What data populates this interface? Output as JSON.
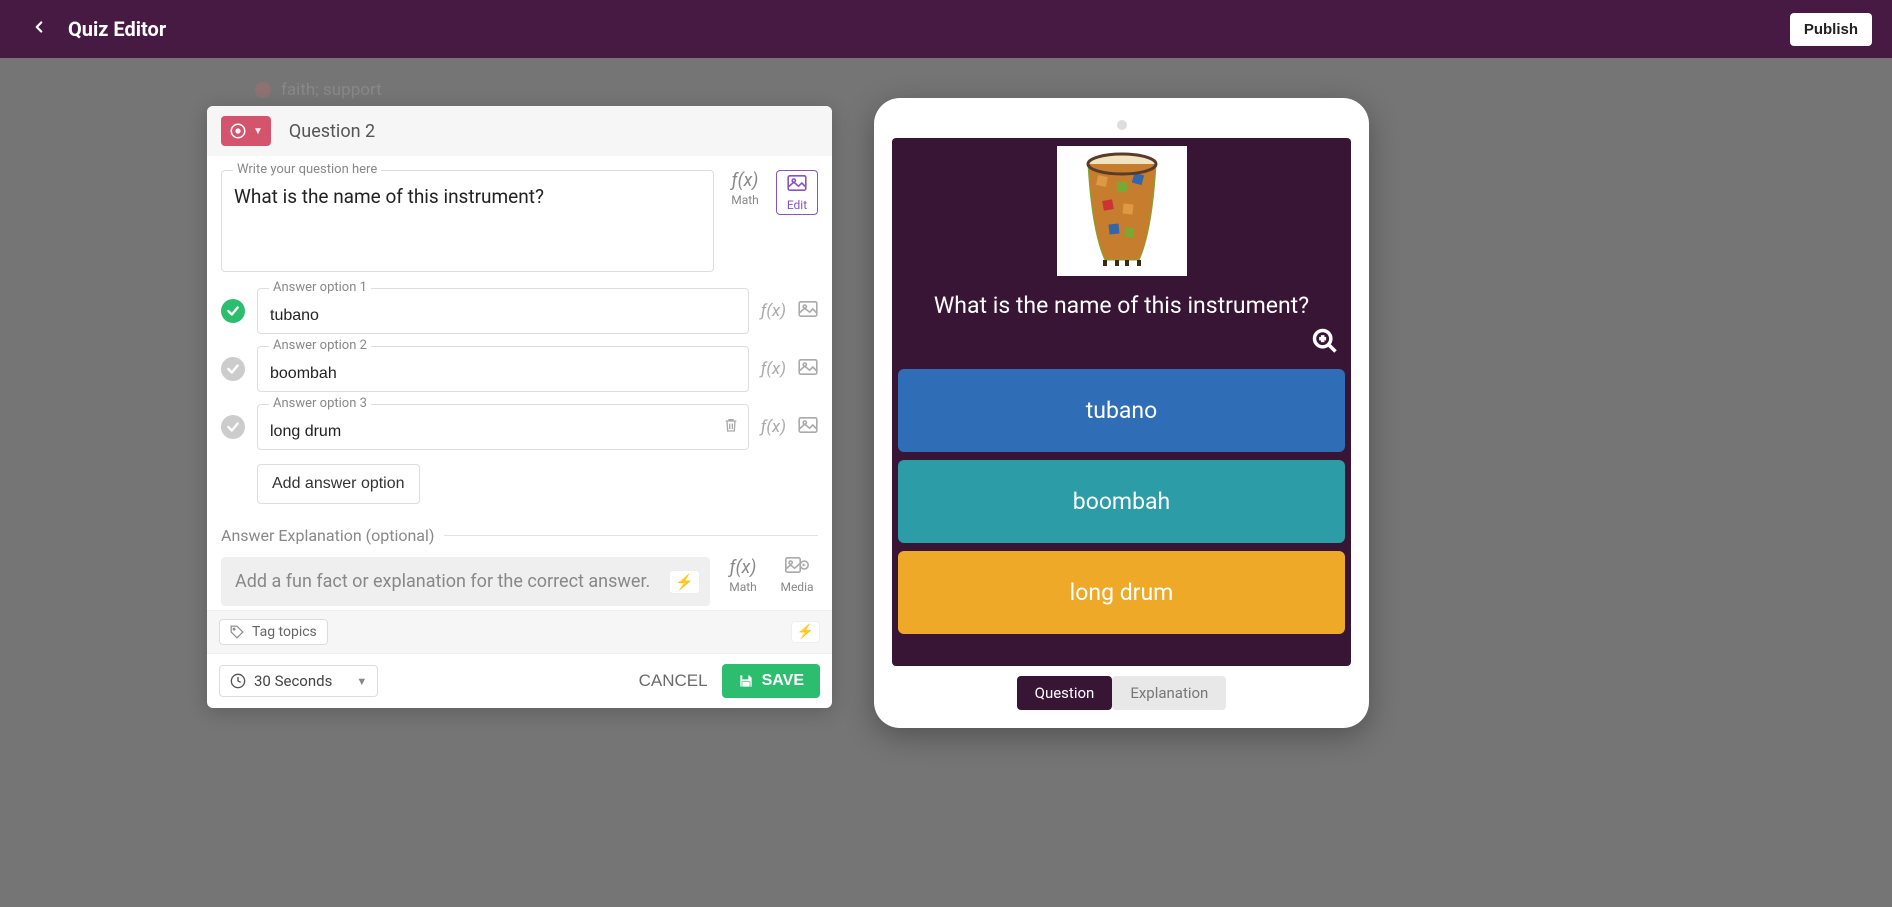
{
  "header": {
    "title": "Quiz Editor",
    "publish_label": "Publish"
  },
  "ghost_text": "faith; support",
  "editor": {
    "question_number_label": "Question 2",
    "question_label": "Write your question here",
    "question_text": "What is the name of this instrument?",
    "math_label": "Math",
    "edit_media_label": "Edit",
    "options": [
      {
        "label": "Answer option 1",
        "value": "tubano",
        "correct": true
      },
      {
        "label": "Answer option 2",
        "value": "boombah",
        "correct": false
      },
      {
        "label": "Answer option 3",
        "value": "long drum",
        "correct": false
      }
    ],
    "add_option_label": "Add answer option",
    "explanation_section_label": "Answer Explanation (optional)",
    "explanation_placeholder": "Add a fun fact or explanation for the correct answer.",
    "explanation_math_label": "Math",
    "explanation_media_label": "Media",
    "tag_topics_label": "Tag topics",
    "time_label": "30 Seconds",
    "cancel_label": "CANCEL",
    "save_label": "SAVE"
  },
  "preview": {
    "question": "What is the name of this instrument?",
    "answers": [
      "tubano",
      "boombah",
      "long drum"
    ],
    "tab_question": "Question",
    "tab_explanation": "Explanation",
    "answer_colors": [
      "#2f6db7",
      "#2c9ca6",
      "#eea929"
    ]
  }
}
